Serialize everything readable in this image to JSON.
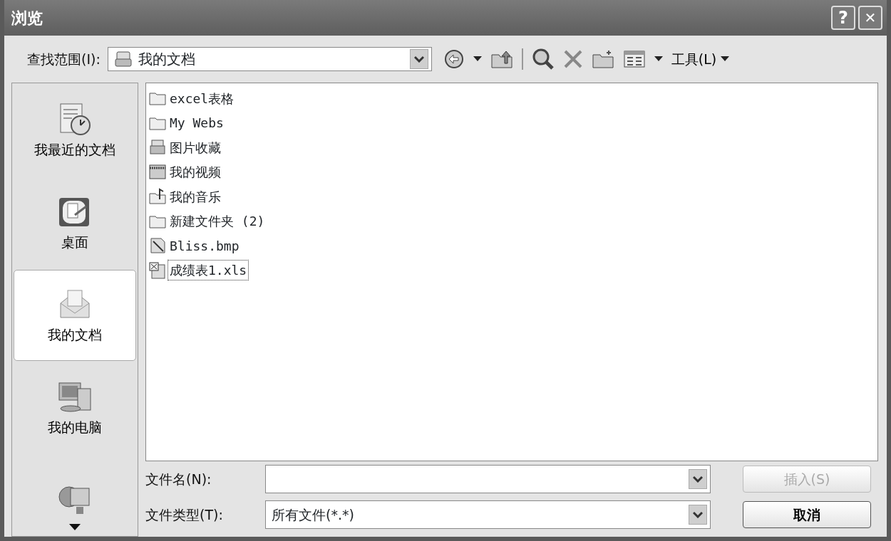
{
  "window": {
    "title": "浏览"
  },
  "title_buttons": [
    {
      "kind": "help",
      "label": "?"
    },
    {
      "kind": "close",
      "label": "✕"
    }
  ],
  "look_in": {
    "label": "查找范围(I):",
    "value": "我的文档"
  },
  "toolbar": {
    "tools_menu": "工具(L)"
  },
  "places": [
    {
      "kind": "recent",
      "label": "我最近的文档",
      "selected": false
    },
    {
      "kind": "desktop",
      "label": "桌面",
      "selected": false
    },
    {
      "kind": "documents",
      "label": "我的文档",
      "selected": true
    },
    {
      "kind": "computer",
      "label": "我的电脑",
      "selected": false
    },
    {
      "kind": "network",
      "selected": false
    }
  ],
  "files": [
    {
      "kind": "folder",
      "name": "excel表格",
      "selected": false
    },
    {
      "kind": "folder",
      "name": "My Webs",
      "selected": false
    },
    {
      "kind": "pictures",
      "name": "图片收藏",
      "selected": false
    },
    {
      "kind": "video",
      "name": "我的视频",
      "selected": false
    },
    {
      "kind": "music",
      "name": "我的音乐",
      "selected": false
    },
    {
      "kind": "folder",
      "name": "新建文件夹 (2)",
      "selected": false
    },
    {
      "kind": "image",
      "name": "Bliss.bmp",
      "selected": false
    },
    {
      "kind": "excel",
      "name": "成绩表1.xls",
      "selected": true
    }
  ],
  "file_name": {
    "label": "文件名(N):"
  },
  "file_type": {
    "label": "文件类型(T):",
    "value": "所有文件(*.*)"
  },
  "buttons": [
    {
      "label": "插入(S)",
      "disabled": true
    },
    {
      "label": "取消",
      "disabled": false
    }
  ]
}
